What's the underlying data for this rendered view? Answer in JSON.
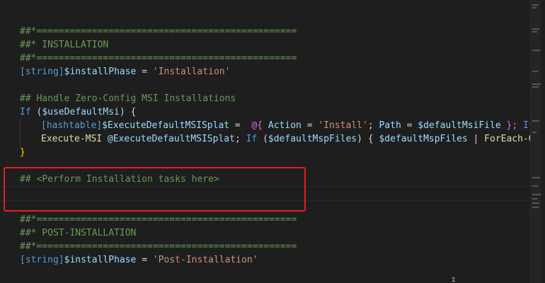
{
  "code": {
    "l1": "##*===============================================",
    "l2": "##* INSTALLATION",
    "l3": "##*===============================================",
    "l4": {
      "type": "[string]",
      "var": "$installPhase",
      "eq": " = ",
      "val": "'Installation'"
    },
    "l6": "## Handle Zero-Config MSI Installations",
    "l7": {
      "if": "If",
      "open": " (",
      "var": "$useDefaultMsi",
      "close": ") {"
    },
    "l8": {
      "type": "[hashtable]",
      "var": "$ExecuteDefaultMSISplat",
      "eq": " =  ",
      "at": "@{",
      "key1": " Action",
      "eq1": " = ",
      "val1": "'Install'",
      "sep": "; ",
      "key2": "Path",
      "eq2": " = ",
      "val2": "$defaultMsiFile",
      "end": " }; ",
      "if": "If"
    },
    "l9": {
      "cmd": "Execute-MSI",
      "splat": " @ExecuteDefaultMSISplat",
      "semi": "; ",
      "if": "If",
      "open": " (",
      "var": "$defaultMspFiles",
      "close": ") { ",
      "var2": "$defaultMspFiles",
      "pipe": " | ",
      "cmd2": "ForEach-Ob"
    },
    "l10": "}",
    "l12": "## <Perform Installation tasks here>",
    "l15": "##*===============================================",
    "l16": "##* POST-INSTALLATION",
    "l17": "##*===============================================",
    "l18": {
      "type": "[string]",
      "var": "$installPhase",
      "eq": " = ",
      "val": "'Post-Installation'"
    }
  },
  "colors": {
    "background": "#1e1e1e",
    "comment": "#6a9955",
    "keyword": "#569cd6",
    "variable": "#9cdcfe",
    "string": "#ce9178",
    "highlight_box": "#e02020"
  }
}
